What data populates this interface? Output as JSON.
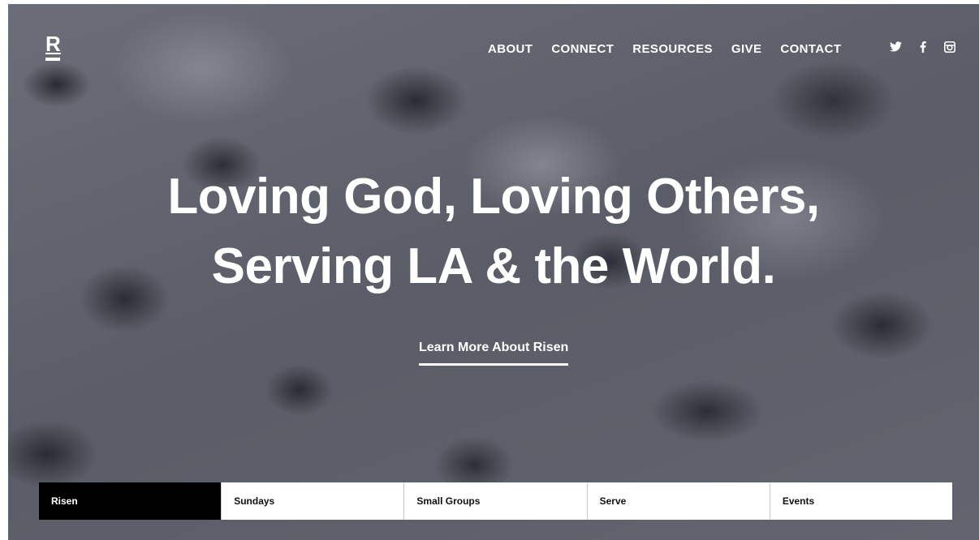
{
  "logo": {
    "letter": "R"
  },
  "nav": {
    "items": [
      {
        "label": "ABOUT"
      },
      {
        "label": "CONNECT"
      },
      {
        "label": "RESOURCES"
      },
      {
        "label": "GIVE"
      },
      {
        "label": "CONTACT"
      }
    ]
  },
  "social": {
    "icons": [
      "twitter-icon",
      "facebook-icon",
      "instagram-icon"
    ],
    "glyphs": [
      "🐦",
      "f",
      "◙"
    ]
  },
  "hero": {
    "headline_line1": "Loving God, Loving Others,",
    "headline_line2": "Serving LA & the World.",
    "cta_label": "Learn More About Risen"
  },
  "tabs": {
    "items": [
      {
        "label": "Risen",
        "active": true
      },
      {
        "label": "Sundays",
        "active": false
      },
      {
        "label": "Small Groups",
        "active": false
      },
      {
        "label": "Serve",
        "active": false
      },
      {
        "label": "Events",
        "active": false
      }
    ]
  },
  "colors": {
    "text": "#ffffff",
    "active_tab_bg": "#000000",
    "tab_bg": "#ffffff"
  }
}
